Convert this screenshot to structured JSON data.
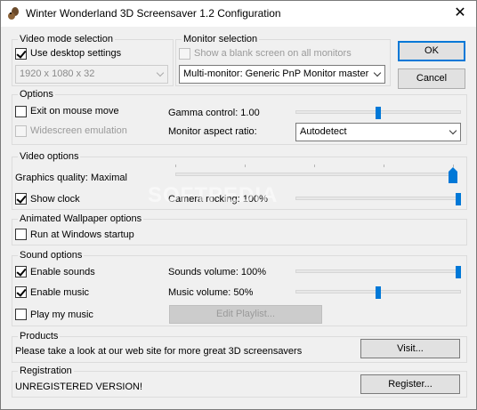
{
  "window": {
    "title": "Winter Wonderland 3D Screensaver 1.2 Configuration",
    "close_glyph": "✕"
  },
  "video_mode": {
    "title": "Video mode selection",
    "use_desktop_label": "Use desktop settings",
    "use_desktop_checked": true,
    "resolution_value": "1920 x 1080 x 32"
  },
  "monitor": {
    "title": "Monitor selection",
    "blank_label": "Show a blank screen on all monitors",
    "monitor_value": "Multi-monitor: Generic PnP Monitor master"
  },
  "buttons": {
    "ok": "OK",
    "cancel": "Cancel",
    "edit_playlist": "Edit Playlist...",
    "visit": "Visit...",
    "register": "Register..."
  },
  "options": {
    "title": "Options",
    "exit_label": "Exit on mouse move",
    "widescreen_label": "Widescreen emulation",
    "gamma_label": "Gamma control: 1.00",
    "gamma_level": 0.5,
    "aspect_label": "Monitor aspect ratio:",
    "aspect_value": "Autodetect"
  },
  "video_options": {
    "title": "Video options",
    "quality_label": "Graphics quality: Maximal",
    "quality_level": 1.0,
    "show_clock_label": "Show clock",
    "camera_label": "Camera rocking: 100%",
    "camera_level": 1.0
  },
  "wallpaper": {
    "title": "Animated Wallpaper options",
    "startup_label": "Run at Windows startup"
  },
  "sound": {
    "title": "Sound options",
    "enable_sounds_label": "Enable sounds",
    "enable_music_label": "Enable music",
    "play_my_music_label": "Play my music",
    "sounds_volume_label": "Sounds volume: 100%",
    "sounds_level": 1.0,
    "music_volume_label": "Music volume: 50%",
    "music_level": 0.5
  },
  "products": {
    "title": "Products",
    "text": "Please take a look at our web site for more great 3D screensavers"
  },
  "registration": {
    "title": "Registration",
    "status": "UNREGISTERED VERSION!"
  },
  "watermark": "SOFTPEDIA",
  "colors": {
    "accent": "#0078d7",
    "background": "#f0f0f0"
  }
}
